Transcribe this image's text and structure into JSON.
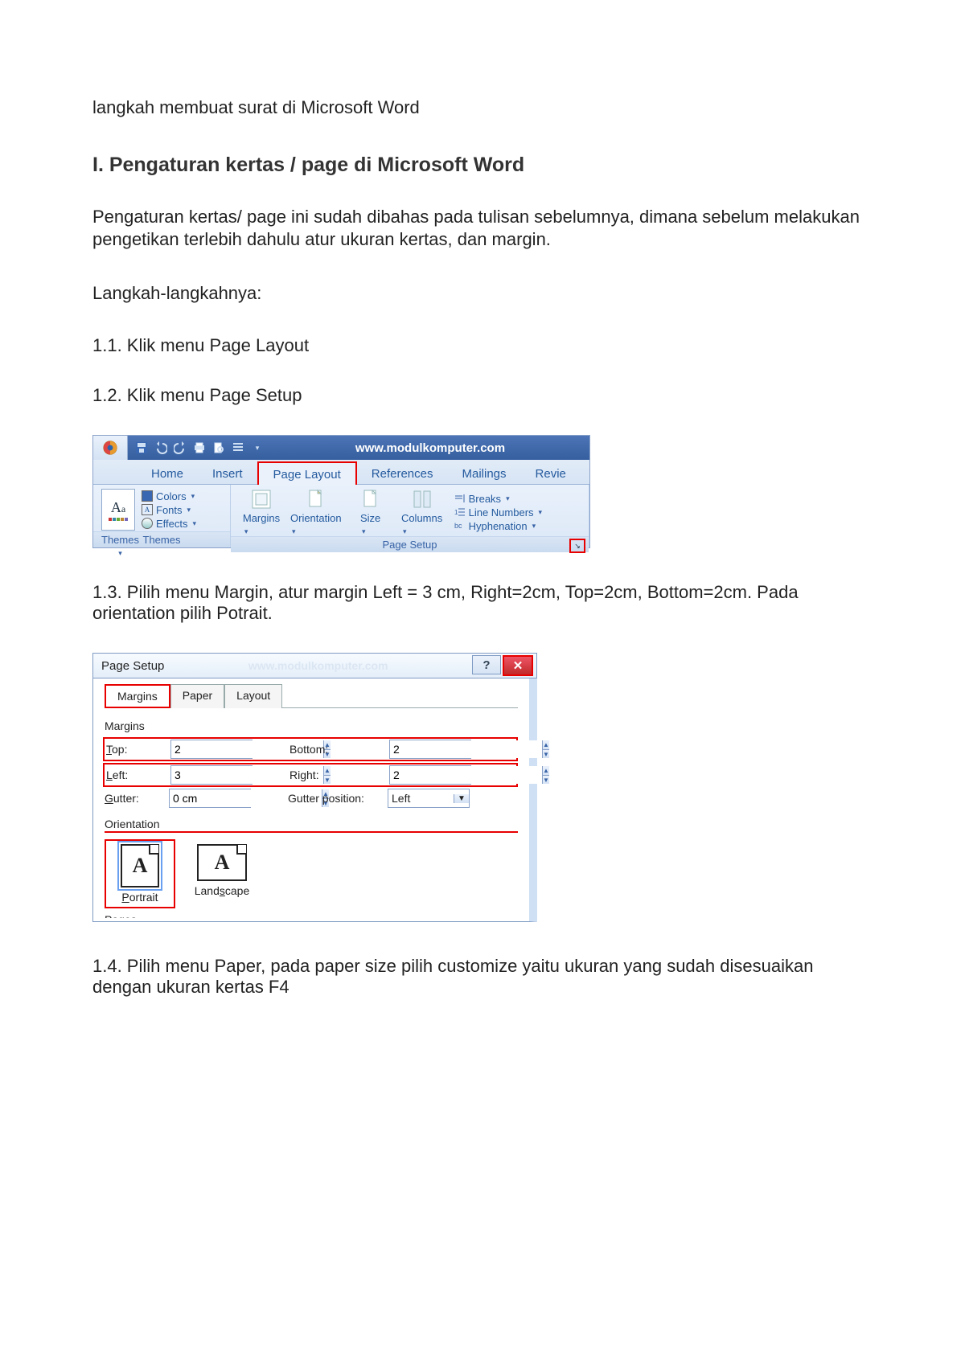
{
  "doc": {
    "intro": "langkah membuat surat di Microsoft Word",
    "h1": "I. Pengaturan kertas / page di Microsoft Word",
    "p1": "Pengaturan kertas/ page ini sudah dibahas pada tulisan sebelumnya, dimana sebelum melakukan pengetikan terlebih dahulu atur ukuran kertas, dan margin.",
    "p2": "Langkah-langkahnya:",
    "s11": "1.1. Klik menu Page Layout",
    "s12": "1.2. Klik menu Page Setup",
    "s13": "1.3. Pilih menu Margin, atur margin Left = 3 cm, Right=2cm, Top=2cm, Bottom=2cm. Pada orientation pilih Potrait.",
    "s14": "1.4. Pilih menu Paper, pada paper size pilih customize yaitu ukuran yang sudah disesuaikan dengan ukuran kertas F4"
  },
  "ribbon": {
    "title": "www.modulkomputer.com",
    "tabs": {
      "home": "Home",
      "insert": "Insert",
      "pageLayout": "Page Layout",
      "references": "References",
      "mailings": "Mailings",
      "review": "Revie"
    },
    "themes": {
      "group": "Themes",
      "colors": "Colors",
      "fonts": "Fonts",
      "effects": "Effects",
      "btn": "Themes"
    },
    "pageSetup": {
      "group": "Page Setup",
      "margins": "Margins",
      "orientation": "Orientation",
      "size": "Size",
      "columns": "Columns",
      "breaks": "Breaks",
      "lineNumbers": "Line Numbers",
      "hyphenation": "Hyphenation"
    }
  },
  "dialog": {
    "title": "Page Setup",
    "watermark": "www.modulkomputer.com",
    "tabs": {
      "margins": "Margins",
      "paper": "Paper",
      "layout": "Layout"
    },
    "section": "Margins",
    "fields": {
      "top": {
        "label": "Top:",
        "value": "2"
      },
      "bottom": {
        "label": "Bottom:",
        "value": "2"
      },
      "left": {
        "label": "Left:",
        "value": "3"
      },
      "right": {
        "label": "Right:",
        "value": "2"
      },
      "gutter": {
        "label": "Gutter:",
        "value": "0 cm"
      },
      "gutterPos": {
        "label": "Gutter position:",
        "value": "Left"
      }
    },
    "orientation": {
      "title": "Orientation",
      "portrait": "Portrait",
      "landscape": "Landscape"
    }
  }
}
